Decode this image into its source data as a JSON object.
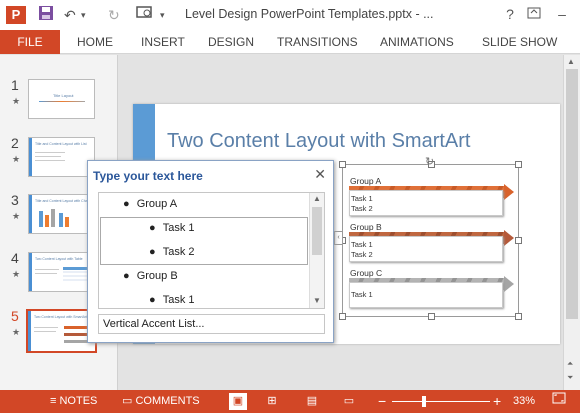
{
  "app": {
    "logo_text": "P",
    "doc_title": "Level Design PowerPoint Templates.pptx - ...",
    "icons": {
      "save": "save-icon",
      "undo": "undo-icon",
      "undo_dropdown": "chevron-down-icon",
      "redo": "redo-icon",
      "present": "present-icon",
      "qat_dropdown": "chevron-down-icon",
      "help": "help-icon",
      "ribbon_display": "ribbon-display-icon",
      "minimize": "minimize-icon"
    }
  },
  "ribbon": {
    "file": "FILE",
    "tabs": [
      "HOME",
      "INSERT",
      "DESIGN",
      "TRANSITIONS",
      "ANIMATIONS",
      "SLIDE SHOW"
    ]
  },
  "thumbnails": [
    {
      "num": "1",
      "star": "★",
      "title": "Title Layout"
    },
    {
      "num": "2",
      "star": "★",
      "title": "Title and Content Layout with List"
    },
    {
      "num": "3",
      "star": "★",
      "title": "Title and Content Layout with Chart"
    },
    {
      "num": "4",
      "star": "★",
      "title": "Two Content Layout with Table"
    },
    {
      "num": "5",
      "star": "★",
      "title": "Two Content Layout with SmartArt",
      "active": true
    }
  ],
  "slide": {
    "title": "Two Content Layout with SmartArt",
    "smartart": {
      "groups": [
        {
          "label": "Group A",
          "tasks": [
            "Task 1",
            "Task 2"
          ],
          "color": "#d9622b"
        },
        {
          "label": "Group B",
          "tasks": [
            "Task 1",
            "Task 2"
          ],
          "color": "#b55a3a"
        },
        {
          "label": "Group C",
          "tasks": [
            "Task 1"
          ],
          "color": "#a5a5a5"
        }
      ]
    }
  },
  "textpane": {
    "title": "Type your text here",
    "close": "✕",
    "items": [
      {
        "text": "Group A",
        "level": 1
      },
      {
        "text": "Task 1",
        "level": 2
      },
      {
        "text": "Task 2",
        "level": 2
      },
      {
        "text": "Group B",
        "level": 1
      },
      {
        "text": "Task 1",
        "level": 2
      }
    ],
    "footer": "Vertical Accent List..."
  },
  "statusbar": {
    "notes": "NOTES",
    "comments": "COMMENTS",
    "zoom": "33%",
    "zoom_level": 0.33,
    "minus": "−",
    "plus": "+"
  },
  "colors": {
    "accent": "#d24726",
    "slide_accent": "#5b9bd5",
    "title": "#5a7fa8"
  }
}
